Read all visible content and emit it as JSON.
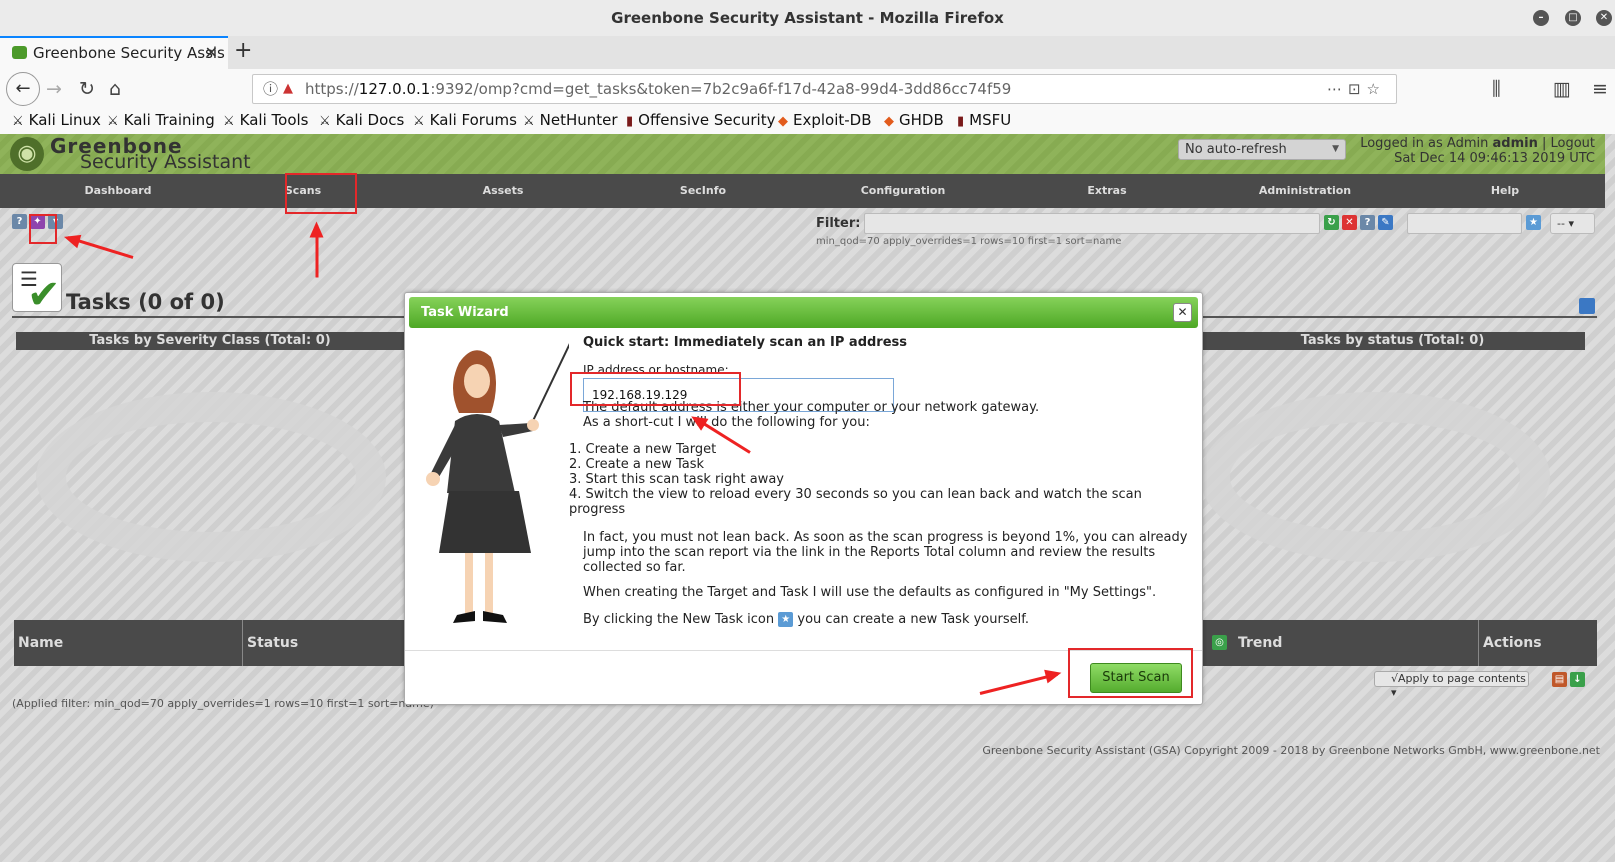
{
  "window": {
    "title": "Greenbone Security Assistant - Mozilla Firefox"
  },
  "tab": {
    "title": "Greenbone Security Assis",
    "close": "✕"
  },
  "url": {
    "protocol": "https://",
    "host": "127.0.0.1",
    "rest": ":9392/omp?cmd=get_tasks&token=7b2c9a6f-f17d-42a8-99d4-3dd86cc74f59"
  },
  "bookmarks": [
    "Kali Linux",
    "Kali Training",
    "Kali Tools",
    "Kali Docs",
    "Kali Forums",
    "NetHunter",
    "Offensive Security",
    "Exploit-DB",
    "GHDB",
    "MSFU"
  ],
  "gsa": {
    "logo_line1": "Greenbone",
    "logo_line2": "Security Assistant",
    "refresh_select": "No auto-refresh",
    "logged_in_as": "Logged in as  Admin ",
    "username": "admin",
    "logout": "Logout",
    "datetime": "Sat Dec 14 09:46:13 2019 UTC",
    "menu": [
      "Dashboard",
      "Scans",
      "Assets",
      "SecInfo",
      "Configuration",
      "Extras",
      "Administration",
      "Help"
    ],
    "filter_label": "Filter:",
    "filter_desc": "min_qod=70 apply_overrides=1 rows=10 first=1 sort=name",
    "small_select": "--",
    "tasks_title": "Tasks (0 of 0)",
    "chart1": "Tasks by Severity Class (Total: 0)",
    "chart2": "Tasks by status (Total: 0)",
    "table_headers": [
      "Name",
      "Status",
      "Trend",
      "Actions"
    ],
    "apply_select": "√Apply to page contents",
    "applied_filter": "(Applied filter: min_qod=70 apply_overrides=1 rows=10 first=1 sort=name)",
    "copyright": "Greenbone Security Assistant (GSA) Copyright 2009 - 2018 by Greenbone Networks GmbH, www.greenbone.net"
  },
  "wizard": {
    "title": "Task Wizard",
    "heading": "Quick start: Immediately scan an IP address",
    "ip_label": "IP address or hostname:",
    "ip_value": "192.168.19.129",
    "p1": "The default address is either your computer or your network gateway.",
    "p2": "As a short-cut I will do the following for you:",
    "steps": [
      "Create a new Target",
      "Create a new Task",
      "Start this scan task right away",
      "Switch the view to reload every 30 seconds so you can lean back and watch the scan progress"
    ],
    "p3": "In fact, you must not lean back. As soon as the scan progress is beyond 1%, you can already jump into the scan report via the link in the Reports Total column and review the results collected so far.",
    "p4": "When creating the Target and Task I will use the defaults as configured in \"My Settings\".",
    "p5a": "By clicking the New Task icon",
    "p5b": "you can create a new Task yourself.",
    "start_button": "Start Scan"
  }
}
